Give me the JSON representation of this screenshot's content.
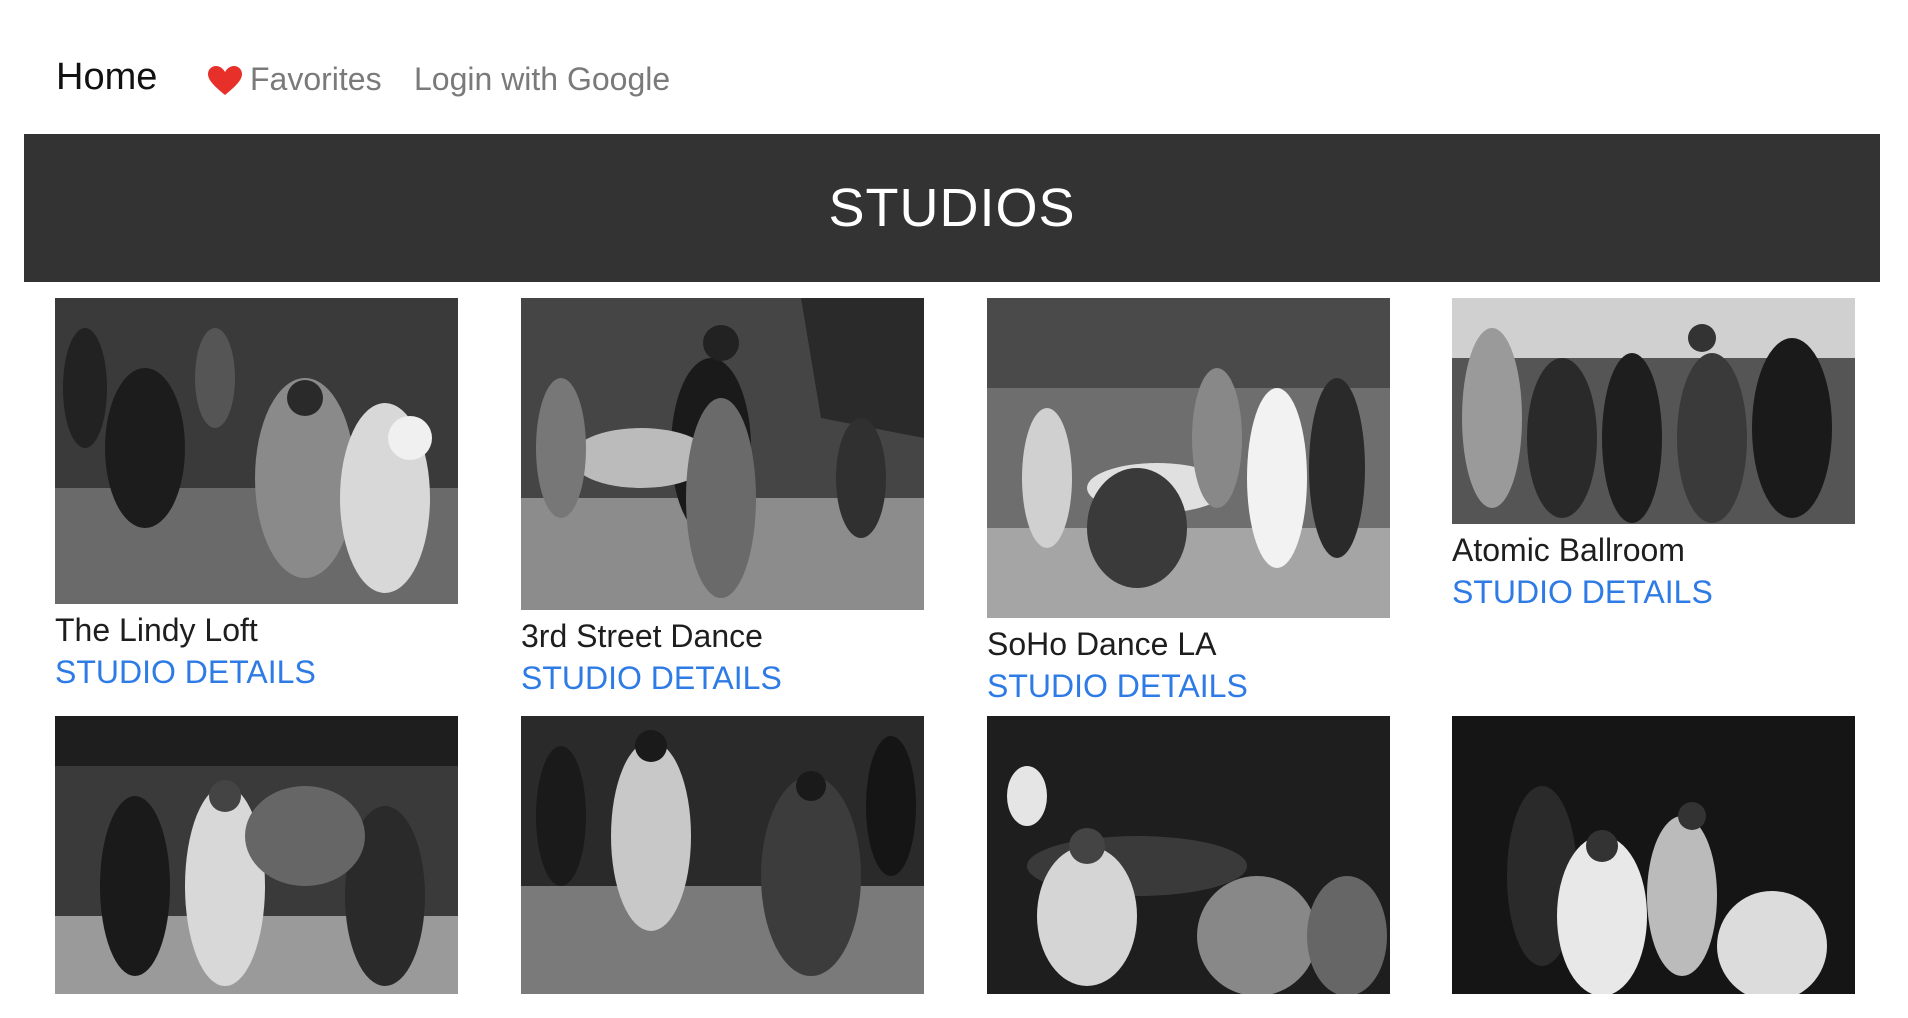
{
  "nav": {
    "home_label": "Home",
    "favorites_label": "Favorites",
    "login_label": "Login with Google"
  },
  "banner": {
    "title": "STUDIOS"
  },
  "colors": {
    "banner_bg": "#333333",
    "link": "#2e7be6",
    "heart": "#e8302a",
    "nav_muted": "#7a7a7a"
  },
  "studios": [
    {
      "name": "The Lindy Loft",
      "details_label": "STUDIO DETAILS",
      "image": "black-and-white swing dancers photo"
    },
    {
      "name": "3rd Street Dance",
      "details_label": "STUDIO DETAILS",
      "image": "black-and-white swing dancers photo"
    },
    {
      "name": "SoHo Dance LA",
      "details_label": "STUDIO DETAILS",
      "image": "black-and-white swing dancers photo"
    },
    {
      "name": "Atomic Ballroom",
      "details_label": "STUDIO DETAILS",
      "image": "black-and-white swing dancers photo"
    },
    {
      "name": "",
      "details_label": "",
      "image": "black-and-white swing dancers photo"
    },
    {
      "name": "",
      "details_label": "",
      "image": "black-and-white swing dancers photo"
    },
    {
      "name": "",
      "details_label": "",
      "image": "black-and-white swing dancers photo"
    },
    {
      "name": "",
      "details_label": "",
      "image": "black-and-white swing dancers photo"
    }
  ]
}
